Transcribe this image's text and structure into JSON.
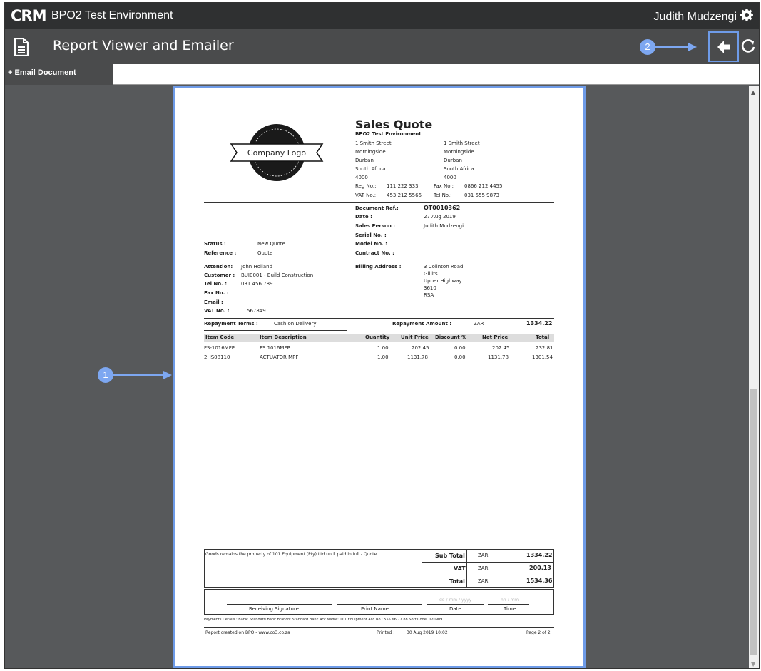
{
  "app": {
    "brand": "CRM",
    "environment": "BPO2 Test Environment",
    "user": "Judith Mudzengi"
  },
  "header": {
    "title": "Report Viewer and Emailer"
  },
  "annotations": {
    "badge1": "1",
    "badge2": "2"
  },
  "tabs": {
    "email_document": "+ Email Document"
  },
  "doc": {
    "title": "Sales Quote",
    "company": "BPO2 Test Environment",
    "logo_text": "Company Logo",
    "address_left": [
      "1 Smith Street",
      "Morningside",
      "Durban",
      "South Africa",
      "4000"
    ],
    "address_right": [
      "1 Smith Street",
      "Morningside",
      "Durban",
      "South Africa",
      "4000"
    ],
    "reg_label": "Reg No.:",
    "reg_value": "111 222 333",
    "fax_label": "Fax No.:",
    "fax_value": "0866 212 4455",
    "vat_label": "VAT No.:",
    "vat_value": "453 212 5566",
    "tel_label": "Tel No.:",
    "tel_value": "031 555 9873",
    "docref_label": "Document Ref.:",
    "docref_value": "QT0010362",
    "date_label": "Date :",
    "date_value": "27 Aug 2019",
    "salesperson_label": "Sales Person :",
    "salesperson_value": "Judith Mudzengi",
    "serial_label": "Serial No. :",
    "model_label": "Model No. :",
    "contract_label": "Contract No. :",
    "status_label": "Status :",
    "status_value": "New Quote",
    "reference_label": "Reference :",
    "reference_value": "Quote",
    "attention_label": "Attention:",
    "attention_value": "John Holland",
    "customer_label": "Customer :",
    "customer_value": "BUI0001 - Build Construction",
    "ctel_label": "Tel No. :",
    "ctel_value": "031 456 789",
    "cfax_label": "Fax No. :",
    "email_label": "Email :",
    "cvat_label": "VAT No. :",
    "cvat_value": "567849",
    "billing_label": "Billing Address :",
    "billing_lines": [
      "3 Colinton Road",
      "Gillits",
      "Upper Highway",
      "3610",
      "RSA"
    ],
    "repay_terms_label": "Repayment Terms :",
    "repay_terms_value": "Cash on Delivery",
    "repay_amount_label": "Repayment Amount :",
    "repay_currency": "ZAR",
    "repay_amount_value": "1334.22",
    "columns": [
      "Item Code",
      "Item Description",
      "Quantity",
      "Unit Price",
      "Discount %",
      "Net Price",
      "Total"
    ],
    "items": [
      [
        "FS-1016MFP",
        "FS 1016MFP",
        "1.00",
        "202.45",
        "0.00",
        "202.45",
        "232.81"
      ],
      [
        "2HS08110",
        "ACTUATOR MPF",
        "1.00",
        "1131.78",
        "0.00",
        "1131.78",
        "1301.54"
      ]
    ],
    "goods_note": "Goods remains the property of 101 Equipment (Pty) Ltd until paid in full - Quote",
    "subtotal_label": "Sub Total",
    "subtotal_currency": "ZAR",
    "subtotal_value": "1334.22",
    "vat_total_label": "VAT",
    "vat_currency": "ZAR",
    "vat_total_value": "200.13",
    "total_label": "Total",
    "total_currency": "ZAR",
    "total_value": "1534.36",
    "sig_receiving": "Receiving Signature",
    "sig_print": "Print Name",
    "sig_date": "Date",
    "sig_time": "Time",
    "date_placeholder": "dd / mm / yyyy",
    "time_placeholder": "hh : mm",
    "payment_details": "Payments Details : Bank: Standard Bank Branch: Standard Bank Acc Name: 101 Equipment Acc No.: 555 66 77 88 Sort Code: 020909",
    "footer_created": "Report created on BPO - www.co3.co.za",
    "footer_printed_label": "Printed :",
    "footer_printed_value": "30 Aug 2019 10:02",
    "footer_page": "Page 2 of 2"
  },
  "colors": {
    "accent": "#7da7f1",
    "topbar": "#2f3031",
    "toolbar": "#4a4b4c",
    "background": "#57595b"
  },
  "icons": {
    "doc": "document-icon",
    "gear": "gear-icon",
    "back": "arrow-left-icon",
    "refresh": "refresh-icon"
  }
}
